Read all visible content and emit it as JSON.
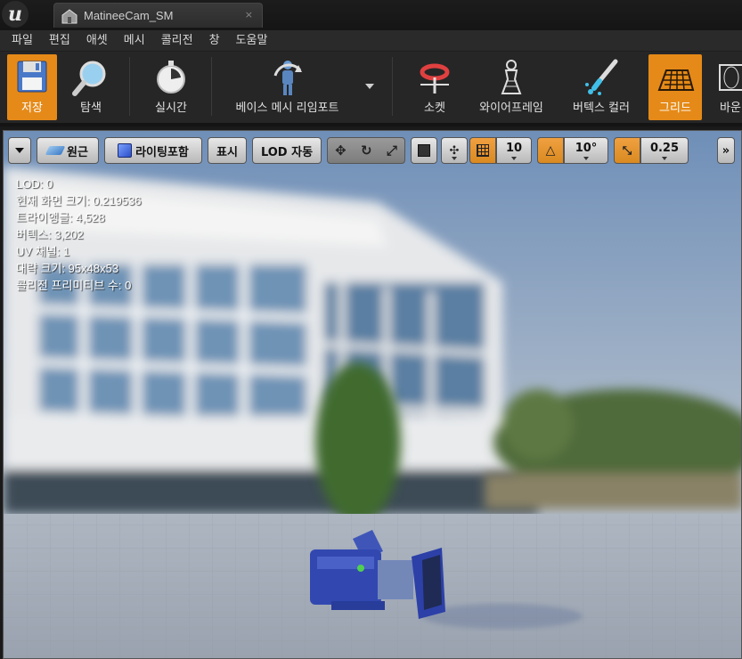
{
  "window": {
    "tab_title": "MatineeCam_SM",
    "tab_close": "×"
  },
  "menu": [
    "파일",
    "편집",
    "애셋",
    "메시",
    "콜리전",
    "창",
    "도움말"
  ],
  "toolbar": {
    "save": "저장",
    "browse": "탐색",
    "realtime": "실시간",
    "reimport": "베이스 메시 리임포트",
    "socket": "소켓",
    "wireframe": "와이어프레임",
    "vertex_color": "버텍스 컬러",
    "grid": "그리드",
    "bounds": "바운"
  },
  "viewport_toolbar": {
    "perspective": "원근",
    "lit": "라이팅포함",
    "show": "표시",
    "lod": "LOD 자동",
    "grid_snap": "10",
    "rotate_snap": "10°",
    "scale_snap": "0.25",
    "overflow": "»"
  },
  "stats": {
    "lod": "LOD:  0",
    "screen_size": "현재 화면 크기: 0.219536",
    "triangles": "트라이앵글: 4,528",
    "vertices": "버텍스: 3,202",
    "uv_channels": "UV 채널:  1",
    "approx_size": "대략 크기: 95x48x53",
    "collision": "콜리전 프리미티브 수: 0"
  },
  "colors": {
    "accent": "#e58a18",
    "toolbar_bg": "#262626",
    "menubar_bg": "#2a2a2a"
  },
  "icons": {
    "logo": "unreal-logo-icon",
    "tab": "static-mesh-icon",
    "save": "floppy-disk-icon",
    "browse": "magnifier-icon",
    "realtime": "stopwatch-icon",
    "reimport": "mannequin-reimport-icon",
    "socket": "socket-icon",
    "wireframe": "wireframe-pawn-icon",
    "vertex_color": "paint-brush-icon",
    "grid": "grid-icon",
    "bounds": "bounds-icon"
  }
}
